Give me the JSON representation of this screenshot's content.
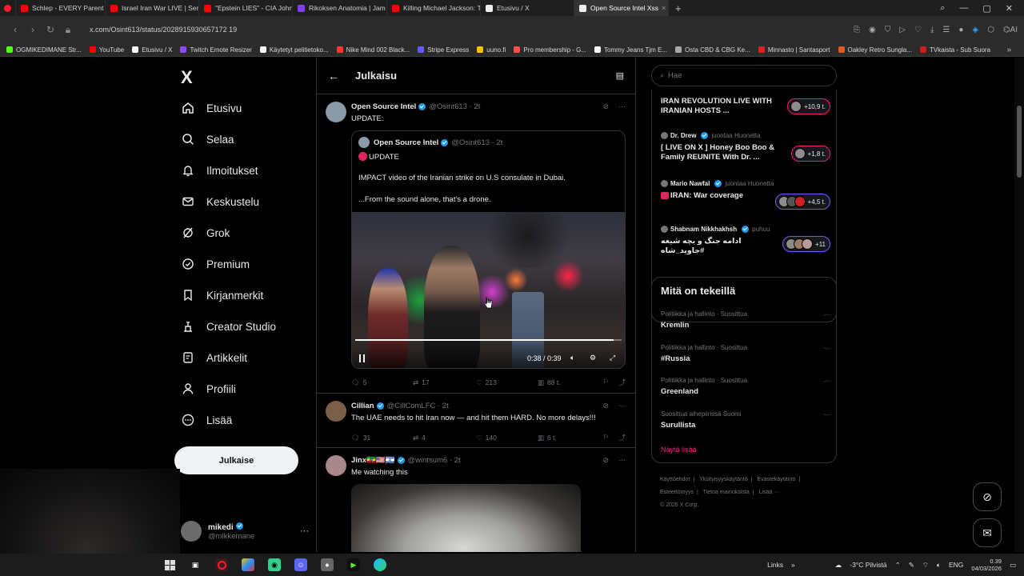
{
  "browser": {
    "tabs": [
      {
        "label": "Schlep - EVERY Parent Ne",
        "color": "#ff0000"
      },
      {
        "label": "Israel Iran War LIVE | Serie",
        "color": "#ff0000"
      },
      {
        "label": "\"Epstein LIES\" - CIA John",
        "color": "#ff0000"
      },
      {
        "label": "Rikoksen Anatomia | Jam",
        "color": "#7e3ff2"
      },
      {
        "label": "Killing Michael Jackson: Ti",
        "color": "#ff0000"
      },
      {
        "label": "Etusivu / X",
        "color": "#ffffff"
      },
      {
        "label": "Open Source Intel Xss",
        "color": "#ffffff"
      }
    ],
    "url": "x.com/Osint613/status/2028915930657172 19",
    "bookmarks": [
      {
        "label": "OGMIKEDIMANE Str...",
        "color": "#53fc18"
      },
      {
        "label": "YouTube",
        "color": "#ff0000"
      },
      {
        "label": "Etusivu / X",
        "color": "#ffffff"
      },
      {
        "label": "Twitch Emote Resizer",
        "color": "#9146ff"
      },
      {
        "label": "Käytetyt pelitietoko...",
        "color": "#ffffff"
      },
      {
        "label": "Nike Mind 002 Black...",
        "color": "#ff3b30"
      },
      {
        "label": "Stripe Express",
        "color": "#635bff"
      },
      {
        "label": "uuno.fi",
        "color": "#f5c400"
      },
      {
        "label": "Pro membership - G...",
        "color": "#ff4d4d"
      },
      {
        "label": "Tommy Jeans Tjm E...",
        "color": "#ffffff"
      },
      {
        "label": "Osta CBD & CBG Ke...",
        "color": "#aaaaaa"
      },
      {
        "label": "Minnasto | Santasport",
        "color": "#e02020"
      },
      {
        "label": "Oakley Retro Sungla...",
        "color": "#e25b1f"
      },
      {
        "label": "TVkaista - Sub Suora",
        "color": "#d01c1c"
      }
    ]
  },
  "nav": {
    "logo": "X",
    "items": [
      {
        "label": "Etusivu",
        "icon": "home-icon"
      },
      {
        "label": "Selaa",
        "icon": "search-icon"
      },
      {
        "label": "Ilmoitukset",
        "icon": "bell-icon"
      },
      {
        "label": "Keskustelu",
        "icon": "mail-icon"
      },
      {
        "label": "Grok",
        "icon": "grok-icon"
      },
      {
        "label": "Premium",
        "icon": "premium-icon"
      },
      {
        "label": "Kirjanmerkit",
        "icon": "bookmark-icon"
      },
      {
        "label": "Creator Studio",
        "icon": "creator-icon"
      },
      {
        "label": "Artikkelit",
        "icon": "article-icon"
      },
      {
        "label": "Profiili",
        "icon": "profile-icon"
      },
      {
        "label": "Lisää",
        "icon": "more-icon"
      }
    ],
    "post_button": "Julkaise",
    "profile": {
      "name": "mikedi",
      "handle": "@mikkemane"
    }
  },
  "main": {
    "title": "Julkaisu",
    "tweets": [
      {
        "name": "Open Source Intel",
        "handle": "@Osint613 · 2t",
        "text": "UPDATE:",
        "quote": {
          "name": "Open Source Intel",
          "handle": "@Osint613 · 2t",
          "line1": "UPDATE",
          "line2": "IMPACT video of the Iranian strike on U.S consulate in Dubai.",
          "line3": "...From the sound alone, that's a drone."
        },
        "video": {
          "time": "0:38 / 0:39",
          "progress": 0.97
        },
        "stats": {
          "replies": "5",
          "reposts": "17",
          "likes": "213",
          "views": "88 t."
        }
      },
      {
        "name": "Cillian",
        "handle": "@CillComLFC · 2t",
        "text": "The UAE needs to hit Iran now — and hit them HARD. No more delays!!!",
        "stats": {
          "replies": "31",
          "reposts": "4",
          "likes": "140",
          "views": "6 t."
        }
      },
      {
        "name": "Jinx🇪🇹🇺🇸🇮🇱",
        "handle": "@wintsum6 · 2t",
        "text": "Me watching this"
      }
    ]
  },
  "right": {
    "search_placeholder": "Hae",
    "live": [
      {
        "host": "",
        "host_label": "",
        "title": "IRAN REVOLUTION LIVE WITH IRANIAN HOSTS ...",
        "count": "+10,9 t.",
        "style": "pink"
      },
      {
        "host": "Dr. Drew",
        "host_label": "juontaa Huonetta",
        "title": "[ LIVE ON X ] Honey Boo Boo & Family REUNITE With Dr. ...",
        "count": "+1,8 t.",
        "style": "pink"
      },
      {
        "host": "Mario Nawfal",
        "host_label": "juontaa Huonetta",
        "title": "IRAN: War coverage",
        "count": "+4,5 t.",
        "style": "purple"
      },
      {
        "host": "Shabnam Nikkhakhsh",
        "host_label": "puhuu",
        "title": "ادامه جنگ و بچه شیعه #جاوید_شاه",
        "count": "+11",
        "style": "purple"
      }
    ],
    "trends_title": "Mitä on tekeillä",
    "trends": [
      {
        "meta": "Politiikka ja hallinto · Suosittua",
        "name": "Kremlin"
      },
      {
        "meta": "Politiikka ja hallinto · Suosittua",
        "name": "#Russia"
      },
      {
        "meta": "Politiikka ja hallinto · Suosittua",
        "name": "Greenland"
      },
      {
        "meta": "Suosittua aihepiirissä Suomi",
        "name": "Surullista"
      }
    ],
    "show_more": "Näytä lisää",
    "footer": [
      "Käyttöehdot",
      "|",
      "Yksityisyyskäytäntö",
      "|",
      "Evästekäytäntö",
      "|",
      "Esteettömyys",
      "|",
      "Tietoa mainoksista",
      "|",
      "Lisää ···",
      "© 2026 X Corp."
    ]
  },
  "taskbar": {
    "links": "Links",
    "weather": "-3°C  Pilvistä",
    "lang": "ENG",
    "time": "0.39",
    "date": "04/03/2026"
  }
}
